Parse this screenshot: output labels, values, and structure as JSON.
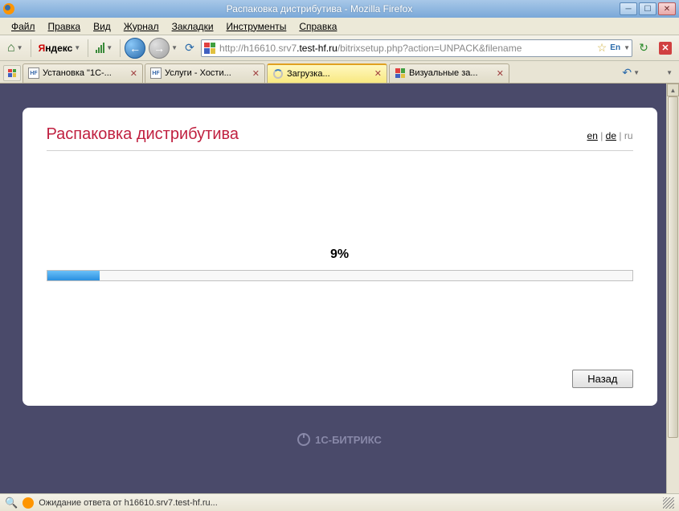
{
  "window": {
    "title": "Распаковка дистрибутива - Mozilla Firefox"
  },
  "menu": {
    "file": "Файл",
    "edit": "Правка",
    "view": "Вид",
    "history": "Журнал",
    "bookmarks": "Закладки",
    "tools": "Инструменты",
    "help": "Справка"
  },
  "toolbar": {
    "yandex_y": "Я",
    "yandex_rest": "ндекс",
    "url_prefix": "http://h16610.srv7",
    "url_bold": ".test-hf.ru",
    "url_suffix": "/bitrixsetup.php?action=UNPACK&filename",
    "en_badge": "En"
  },
  "tabs": [
    {
      "label": "Установка \"1С-...",
      "active": false,
      "icon": "hf"
    },
    {
      "label": "Услуги - Хости...",
      "active": false,
      "icon": "hf"
    },
    {
      "label": "Загрузка...",
      "active": true,
      "icon": "spinner"
    },
    {
      "label": "Визуальные за...",
      "active": false,
      "icon": "grid"
    }
  ],
  "page": {
    "title": "Распаковка дистрибутива",
    "lang": {
      "en": "en",
      "de": "de",
      "ru": "ru"
    },
    "progress_percent": 9,
    "progress_label": "9%",
    "back_button": "Назад",
    "brand": "1С-БИТРИКС"
  },
  "status": {
    "text": "Ожидание ответа от h16610.srv7.test-hf.ru..."
  }
}
